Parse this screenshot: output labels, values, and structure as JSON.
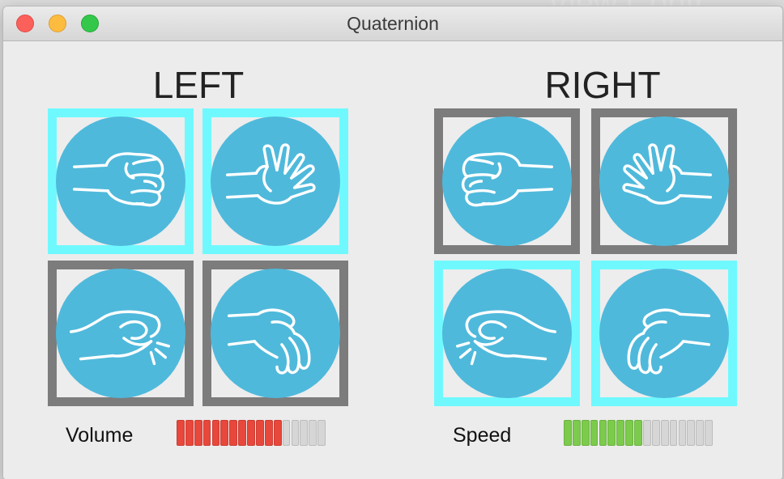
{
  "window": {
    "title": "Quaternion"
  },
  "backdrop": {
    "text": "View Contr"
  },
  "left": {
    "heading": "LEFT",
    "tiles": [
      {
        "gesture": "fist",
        "active": true
      },
      {
        "gesture": "open-hand",
        "active": true
      },
      {
        "gesture": "pinch-snap",
        "active": false
      },
      {
        "gesture": "cupped-hand",
        "active": false
      }
    ],
    "meter": {
      "label": "Volume",
      "level": 12,
      "segments": 17,
      "color": "#e8473b"
    }
  },
  "right": {
    "heading": "RIGHT",
    "tiles": [
      {
        "gesture": "fist",
        "active": false
      },
      {
        "gesture": "open-hand",
        "active": false
      },
      {
        "gesture": "pinch-snap",
        "active": true
      },
      {
        "gesture": "cupped-hand",
        "active": true
      }
    ],
    "meter": {
      "label": "Speed",
      "level": 9,
      "segments": 17,
      "color": "#7ccb4c"
    }
  },
  "colors": {
    "tile_active_border": "#6ff9ff",
    "tile_inactive_border": "#7c7c7c",
    "disc": "#4fb9db",
    "meter_off": "#d6d6d6"
  }
}
